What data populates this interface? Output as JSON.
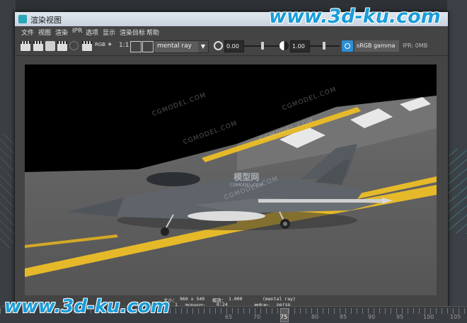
{
  "window": {
    "title": "渲染视图"
  },
  "menu": [
    "文件",
    "视图",
    "渲染",
    "IPR",
    "选项",
    "显示",
    "渲染目标",
    "帮助"
  ],
  "toolbar": {
    "rgb_label": "RGB",
    "ratio_label": "1:1",
    "renderer": "mental ray",
    "exposure_value": "0.00",
    "gamma_value": "1.00",
    "color_profile": "sRGB gamma",
    "ipr_memory": "IPR: 0MB"
  },
  "viewport": {
    "watermarks": [
      "CGMODEL.COM",
      "CGMODEL.COM",
      "CGMODEL.COM",
      "CGMODEL.COM",
      "CGMODEL.COM"
    ],
    "center_logo": "模型网",
    "center_logo_sub": "CGMODEL.COM"
  },
  "status": {
    "size_label": "大小：",
    "size_value": "960 x 540",
    "zoom_label": "缩放：",
    "zoom_value": "1.000",
    "renderer_value": "(mental ray)",
    "frame_label": "帧：",
    "frame_value": "1",
    "time_label": "渲染时间：",
    "time_value": "0:24",
    "camera_label": "摄影机：",
    "camera_value": "persp"
  },
  "timeline": {
    "ticks": [
      "65",
      "70",
      "75",
      "80",
      "85",
      "90",
      "95",
      "100",
      "105"
    ],
    "current": "75"
  },
  "site_watermark": "www.3d-ku.com",
  "colors": {
    "accent": "#2d8fd6",
    "road_line": "#e5b92a",
    "jet": "#5f646b"
  }
}
